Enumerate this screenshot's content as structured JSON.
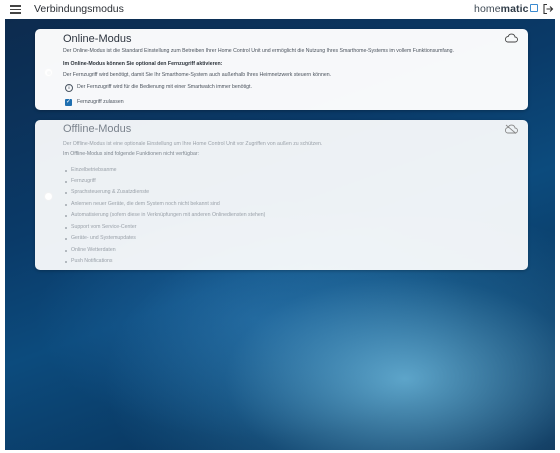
{
  "header": {
    "title": "Verbindungsmodus",
    "brand_prefix": "home",
    "brand_suffix": "matic"
  },
  "icons": {
    "menu": "hamburger-menu-icon",
    "logout": "logout-icon",
    "cloud_online": "cloud-icon",
    "cloud_offline": "cloud-off-icon",
    "info": "info-icon",
    "check": "check-icon"
  },
  "online": {
    "selected": true,
    "title": "Online-Modus",
    "description": "Der Online-Modus ist die Standard Einstellung zum Betreiben Ihrer Home Control Unit und ermöglicht die Nutzung Ihres Smarthome-Systems im vollem Funktionsumfang.",
    "remote_heading": "Im Online-Modus können Sie optional den Fernzugriff aktivieren:",
    "remote_text": "Der Fernzugriff wird benötigt, damit Sie Ihr Smarthome-System auch außerhalb Ihres Heimnetzwerk steuern können.",
    "info_text": "Der Fernzugriff wird für die Bedienung mit einer Smartwatch immer benötigt.",
    "checkbox_label": "Fernzugriff zulassen",
    "checkbox_checked": true
  },
  "offline": {
    "selected": false,
    "title": "Offline-Modus",
    "description": "Der Offline-Modus ist eine optionale Einstellung um Ihre Home Control Unit vor Zugriffen von außen zu schützen.",
    "functions_heading": "Im Offline-Modus sind folgende Funktionen nicht verfügbar:",
    "functions": [
      "Einzelbetriebsanme",
      "Fernzugriff",
      "Sprachsteuerung & Zusatzdienste",
      "Anlernen neuer Geräte, die dem System noch nicht bekannt sind",
      "Automatisierung (sofern diese in Verknüpfungen mit anderen Onlinediensten stehen)",
      "Support vom Service-Center",
      "Geräte- und Systemupdates",
      "Online Wetterdaten",
      "Push Notifications"
    ]
  }
}
